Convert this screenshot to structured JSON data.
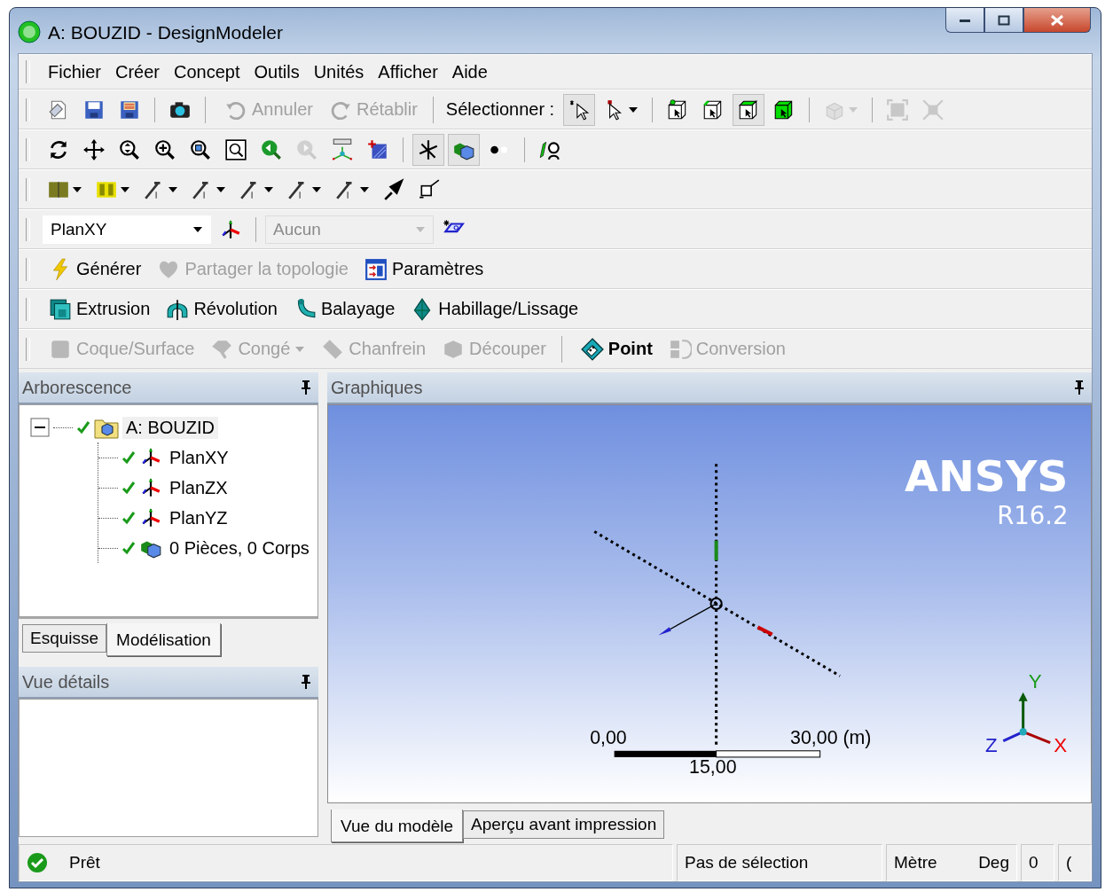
{
  "window": {
    "title": "A: BOUZID - DesignModeler"
  },
  "menu": [
    "Fichier",
    "Créer",
    "Concept",
    "Outils",
    "Unités",
    "Afficher",
    "Aide"
  ],
  "toolbars": [
    [
      {
        "kind": "icon",
        "pressed": false,
        "disabled": false
      },
      {
        "kind": "icon",
        "pressed": false,
        "disabled": false
      },
      {
        "kind": "icon",
        "pressed": false,
        "disabled": false
      },
      {
        "kind": "separator"
      },
      {
        "kind": "icon",
        "pressed": false,
        "disabled": false
      },
      {
        "kind": "group-end"
      },
      {
        "kind": "button",
        "label": "Annuler",
        "disabled": true
      },
      {
        "kind": "button",
        "label": "Rétablir",
        "disabled": true
      },
      {
        "kind": "group-end"
      },
      {
        "kind": "label",
        "label": "Sélectionner :"
      },
      {
        "kind": "icon",
        "pressed": true,
        "disabled": false
      },
      {
        "kind": "icon-menu",
        "pressed": false,
        "disabled": false
      },
      {
        "kind": "separator"
      },
      {
        "kind": "icon",
        "pressed": false,
        "disabled": false
      },
      {
        "kind": "icon",
        "pressed": false,
        "disabled": false
      },
      {
        "kind": "icon",
        "pressed": true,
        "disabled": false
      },
      {
        "kind": "icon",
        "pressed": false,
        "disabled": false
      },
      {
        "kind": "separator"
      },
      {
        "kind": "icon-menu",
        "pressed": false,
        "disabled": true
      },
      {
        "kind": "separator"
      },
      {
        "kind": "icon",
        "pressed": false,
        "disabled": true
      },
      {
        "kind": "icon",
        "pressed": false,
        "disabled": true
      }
    ],
    [
      {
        "kind": "icon",
        "pressed": false,
        "disabled": false
      },
      {
        "kind": "icon",
        "pressed": false,
        "disabled": false
      },
      {
        "kind": "icon",
        "pressed": false,
        "disabled": false
      },
      {
        "kind": "icon",
        "pressed": false,
        "disabled": false
      },
      {
        "kind": "icon",
        "pressed": false,
        "disabled": false
      },
      {
        "kind": "icon",
        "pressed": false,
        "disabled": false
      },
      {
        "kind": "icon",
        "pressed": false,
        "disabled": false
      },
      {
        "kind": "icon",
        "pressed": false,
        "disabled": true
      },
      {
        "kind": "icon",
        "pressed": false,
        "disabled": false
      },
      {
        "kind": "icon",
        "pressed": false,
        "disabled": false
      },
      {
        "kind": "separator"
      },
      {
        "kind": "icon",
        "pressed": true,
        "disabled": false
      },
      {
        "kind": "icon",
        "pressed": true,
        "disabled": false
      },
      {
        "kind": "icon",
        "pressed": false,
        "disabled": false
      },
      {
        "kind": "separator"
      },
      {
        "kind": "icon",
        "pressed": false,
        "disabled": false
      }
    ],
    [
      {
        "kind": "icon-menu",
        "pressed": false,
        "disabled": false
      },
      {
        "kind": "icon-menu",
        "pressed": false,
        "disabled": false
      },
      {
        "kind": "icon-menu",
        "pressed": false,
        "disabled": false
      },
      {
        "kind": "icon-menu",
        "pressed": false,
        "disabled": false
      },
      {
        "kind": "icon-menu",
        "pressed": false,
        "disabled": false
      },
      {
        "kind": "icon-menu",
        "pressed": false,
        "disabled": false
      },
      {
        "kind": "icon-menu",
        "pressed": false,
        "disabled": false
      },
      {
        "kind": "icon",
        "pressed": false,
        "disabled": false
      },
      {
        "kind": "icon",
        "pressed": false,
        "disabled": false
      }
    ],
    [
      {
        "kind": "dropdown",
        "value": "PlanXY",
        "disabled": false
      },
      {
        "kind": "icon",
        "pressed": false,
        "disabled": false
      },
      {
        "kind": "separator"
      },
      {
        "kind": "dropdown",
        "value": "Aucun",
        "disabled": true
      },
      {
        "kind": "icon",
        "pressed": false,
        "disabled": false
      }
    ],
    [
      {
        "kind": "button",
        "label": "Générer",
        "disabled": false
      },
      {
        "kind": "button",
        "label": "Partager la topologie",
        "disabled": true
      },
      {
        "kind": "button",
        "label": "Paramètres",
        "disabled": false
      }
    ],
    [
      {
        "kind": "button",
        "label": "Extrusion",
        "disabled": false
      },
      {
        "kind": "button",
        "label": "Révolution",
        "disabled": false
      },
      {
        "kind": "button",
        "label": "Balayage",
        "disabled": false
      },
      {
        "kind": "button",
        "label": "Habillage/Lissage",
        "disabled": false
      }
    ],
    [
      {
        "kind": "button",
        "label": "Coque/Surface",
        "disabled": true
      },
      {
        "kind": "button-menu",
        "label": "Congé",
        "disabled": true
      },
      {
        "kind": "button",
        "label": "Chanfrein",
        "disabled": true
      },
      {
        "kind": "button",
        "label": "Découper",
        "disabled": true
      },
      {
        "kind": "group-end"
      },
      {
        "kind": "button",
        "label": "Point",
        "disabled": false
      },
      {
        "kind": "button",
        "label": "Conversion",
        "disabled": true
      }
    ]
  ],
  "tree_panel": {
    "title": "Arborescence",
    "tree": [
      {
        "kind": "root",
        "label": "A: BOUZID",
        "expanded": true,
        "children": [
          {
            "kind": "plane",
            "label": "PlanXY"
          },
          {
            "kind": "plane",
            "label": "PlanZX"
          },
          {
            "kind": "plane",
            "label": "PlanYZ"
          },
          {
            "kind": "bodies",
            "label": "0 Pièces, 0 Corps"
          }
        ]
      }
    ],
    "tabs": [
      {
        "label": "Esquisse",
        "selected": false
      },
      {
        "label": "Modélisation",
        "selected": true
      }
    ]
  },
  "details_panel": {
    "title": "Vue détails"
  },
  "graphics_panel": {
    "title": "Graphiques",
    "logo": {
      "brand": "ANSYS",
      "version": "R16.2"
    },
    "scale": {
      "start": "0,00",
      "end": "30,00 (m)",
      "middle": "15,00"
    },
    "triad": {
      "y": "Y",
      "z": "Z",
      "x": "X"
    },
    "tabs": [
      {
        "label": "Vue du modèle",
        "selected": true
      },
      {
        "label": "Aperçu avant impression",
        "selected": false
      }
    ]
  },
  "status_bar": {
    "state": "Prêt",
    "selection": "Pas de sélection",
    "unit": "Mètre",
    "angle": "Deg",
    "field_1": "0",
    "field_2": "("
  }
}
